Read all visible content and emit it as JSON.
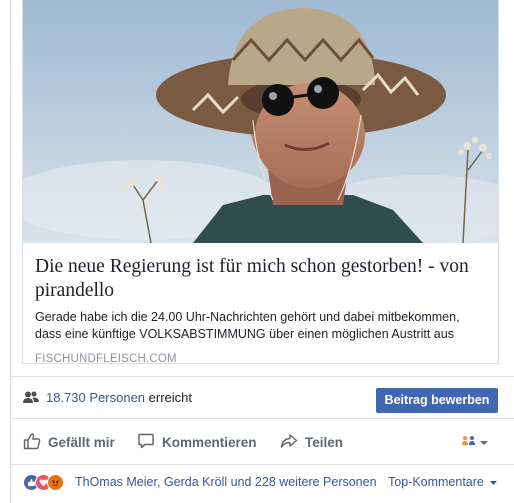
{
  "link_preview": {
    "title": "Die neue Regierung ist für mich schon gestorben! - von pirandello",
    "description": "Gerade habe ich die 24.00 Uhr-Nachrichten gehört und dabei mitbekommen, dass eine künftige VOLKSABSTIMMUNG über einen möglichen Austritt aus dem…",
    "domain": "FISCHUNDFLEISCH.COM"
  },
  "reach": {
    "count": "18.730",
    "people_label": "Personen",
    "suffix": "erreicht",
    "boost_label": "Beitrag bewerben",
    "icon": "people-icon"
  },
  "actions": {
    "like_label": "Gefällt mir",
    "comment_label": "Kommentieren",
    "share_label": "Teilen",
    "audience_icon": "audience-selector-icon"
  },
  "summary": {
    "reactions": [
      "like",
      "love",
      "angry"
    ],
    "people_text": "ThOmas Meier, Gerda Kröll und 228 weitere Personen",
    "sort_label": "Top-Kommentare"
  },
  "colors": {
    "link": "#365899",
    "button": "#4267b2",
    "muted": "#606770",
    "like": "#4267b2",
    "love": "#f25268",
    "angry": "#e9710f"
  }
}
